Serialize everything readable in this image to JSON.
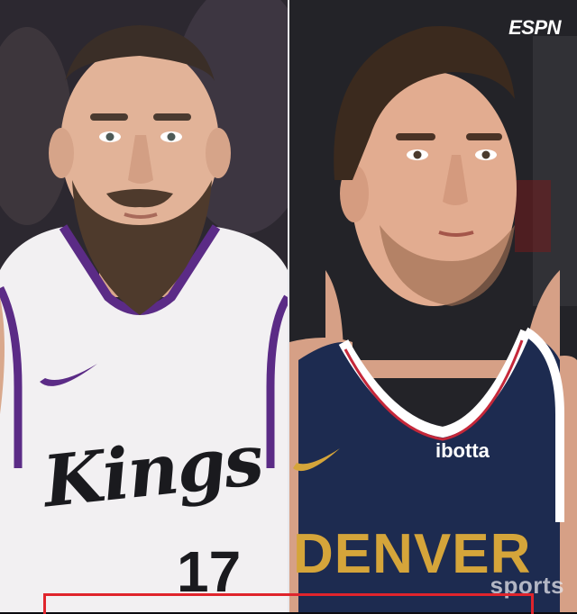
{
  "brand": {
    "logo": "ESPN",
    "watermark": "sports"
  },
  "left_player": {
    "jersey_wordmark": "Kings",
    "number": "17",
    "jersey_color": "#f2f0f2",
    "trim_color": "#5b2b86"
  },
  "right_player": {
    "jersey_wordmark": "DENVER",
    "sponsor": "ibotta",
    "jersey_color": "#1d2b50",
    "trim_color": "#d5a53a"
  },
  "colors": {
    "accent_red": "#e0242c",
    "divider": "#e8e8ec"
  }
}
